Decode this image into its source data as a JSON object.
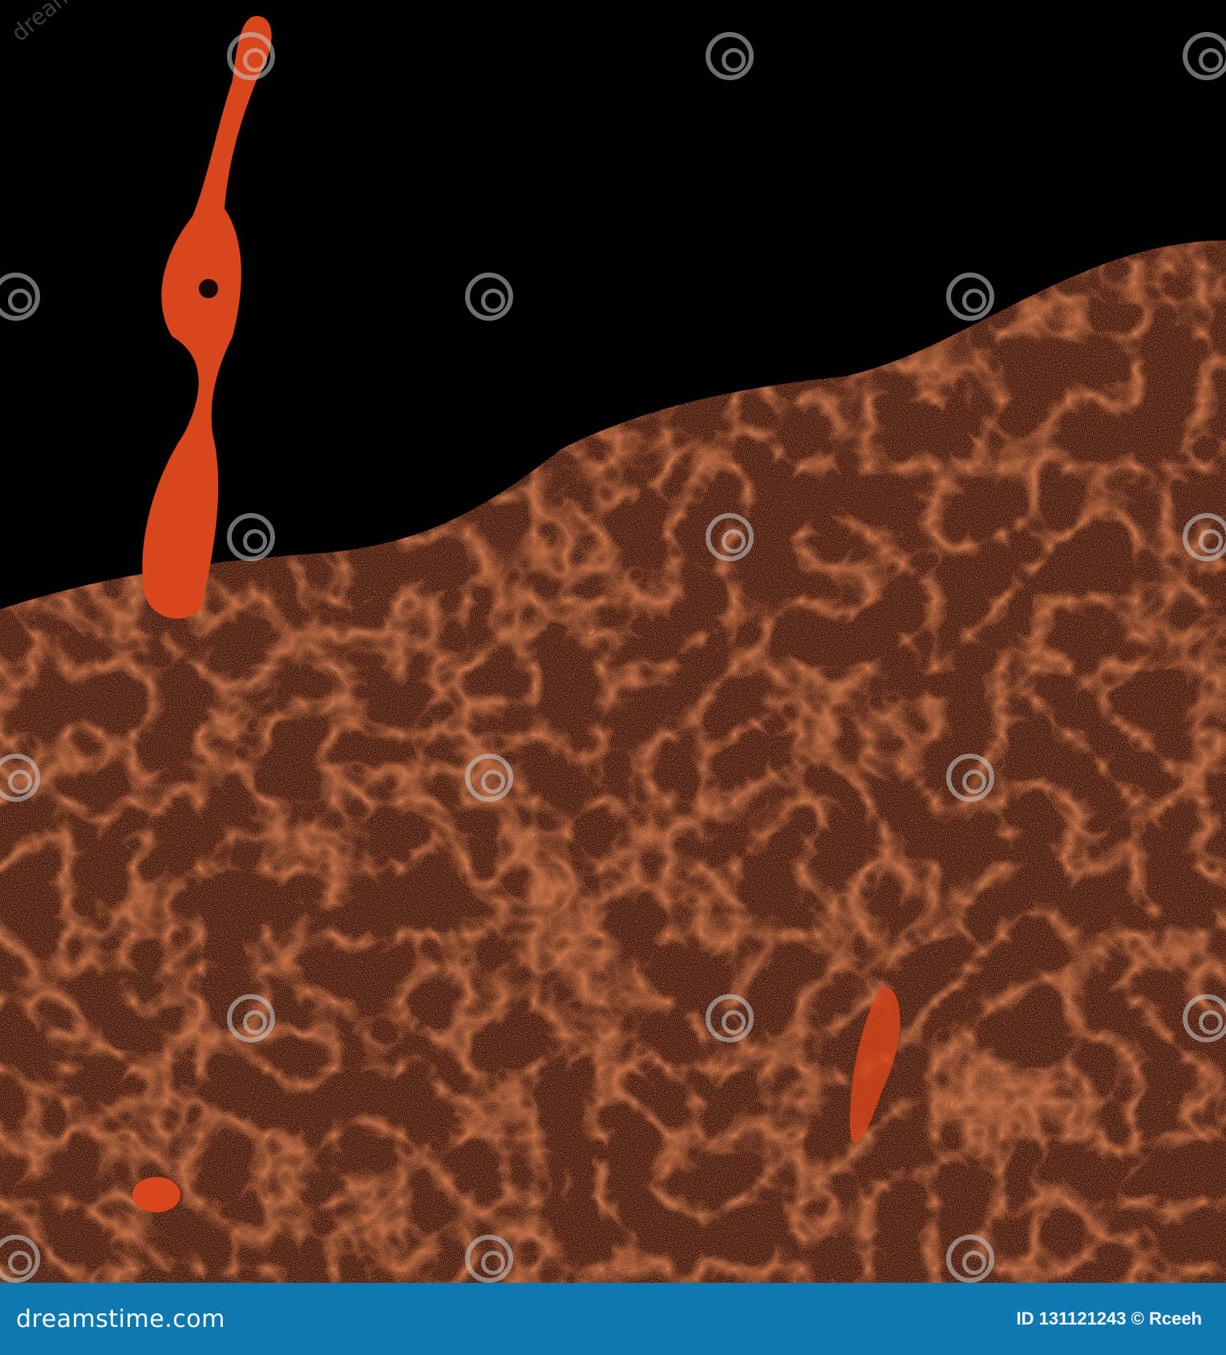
{
  "footer": {
    "logo_text": "dreamstime.com",
    "credit_text": "ID 131121243 © Rceeh"
  },
  "watermark_text": "dreamstime",
  "colors": {
    "footer_bg": "#0f78b0",
    "texture_dark": "#2a0d07",
    "texture_orange": "#e0421a"
  }
}
